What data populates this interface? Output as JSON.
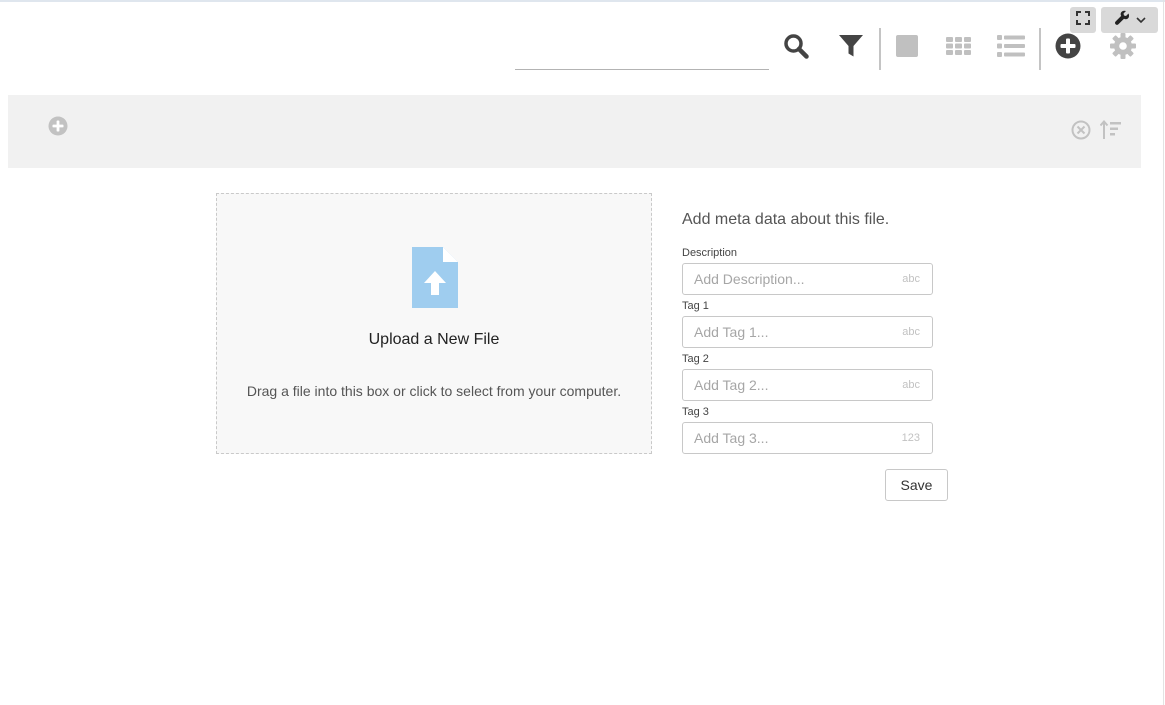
{
  "search": {
    "value": "",
    "placeholder": ""
  },
  "icons": {
    "search": "search-icon",
    "filter": "filter-icon",
    "tile_view": "square-view-icon",
    "grid_view": "grid-view-icon",
    "list_view": "list-view-icon",
    "add": "plus-circle-icon",
    "settings": "gear-icon",
    "fullscreen": "expand-icon",
    "tools": "wrench-icon",
    "band_add": "plus-circle-icon",
    "clear": "clear-circle-icon",
    "sort": "sort-icon",
    "upload": "file-upload-icon"
  },
  "upload": {
    "title": "Upload a New File",
    "hint": "Drag a file into this box or click to select from your computer."
  },
  "meta": {
    "title": "Add meta data about this file.",
    "fields": [
      {
        "label": "Description",
        "placeholder": "Add Description...",
        "type": "abc"
      },
      {
        "label": "Tag 1",
        "placeholder": "Add Tag 1...",
        "type": "abc"
      },
      {
        "label": "Tag 2",
        "placeholder": "Add Tag 2...",
        "type": "abc"
      },
      {
        "label": "Tag 3",
        "placeholder": "Add Tag 3...",
        "type": "123"
      }
    ],
    "save_label": "Save"
  },
  "colors": {
    "icon_dark": "#444444",
    "icon_light": "#c0c0c0",
    "upload_icon": "#9fcdef",
    "band_bg": "#f1f1f1"
  }
}
